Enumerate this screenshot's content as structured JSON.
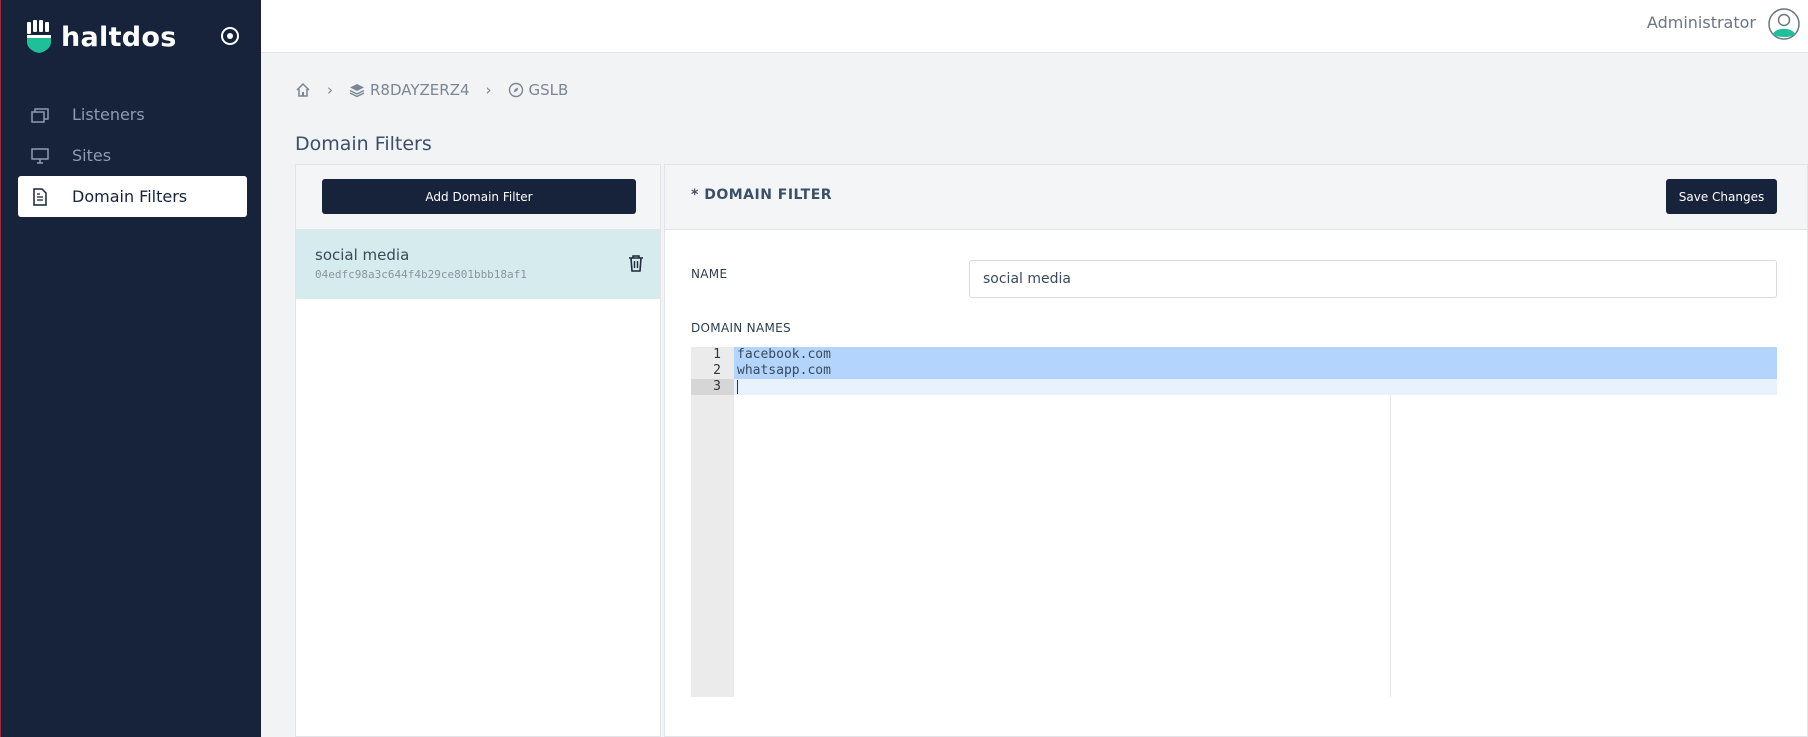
{
  "app": {
    "brand": "haltdos",
    "colors": {
      "sidebar": "#16233b",
      "accent": "#1fbf9a",
      "selected_item": "#d6ebed",
      "selection": "#b3d4fc"
    }
  },
  "sidebar": {
    "items": [
      {
        "label": "Listeners",
        "icon": "windows-icon",
        "active": false
      },
      {
        "label": "Sites",
        "icon": "monitor-icon",
        "active": false
      },
      {
        "label": "Domain Filters",
        "icon": "document-icon",
        "active": true
      }
    ]
  },
  "header": {
    "user": "Administrator"
  },
  "breadcrumb": {
    "items": [
      {
        "label": "",
        "icon": "home-icon"
      },
      {
        "label": "R8DAYZERZ4",
        "icon": "layers-icon"
      },
      {
        "label": "GSLB",
        "icon": "compass-icon"
      }
    ]
  },
  "page": {
    "title": "Domain Filters"
  },
  "list": {
    "add_label": "Add Domain Filter",
    "items": [
      {
        "name": "social media",
        "id": "04edfc98a3c644f4b29ce801bbb18af1"
      }
    ]
  },
  "detail": {
    "title": "* DOMAIN FILTER",
    "save_label": "Save Changes",
    "name_label": "NAME",
    "name_value": "social media",
    "domains_label": "DOMAIN NAMES",
    "lines": [
      {
        "num": "1",
        "text": "facebook.com"
      },
      {
        "num": "2",
        "text": "whatsapp.com"
      },
      {
        "num": "3",
        "text": ""
      }
    ]
  }
}
